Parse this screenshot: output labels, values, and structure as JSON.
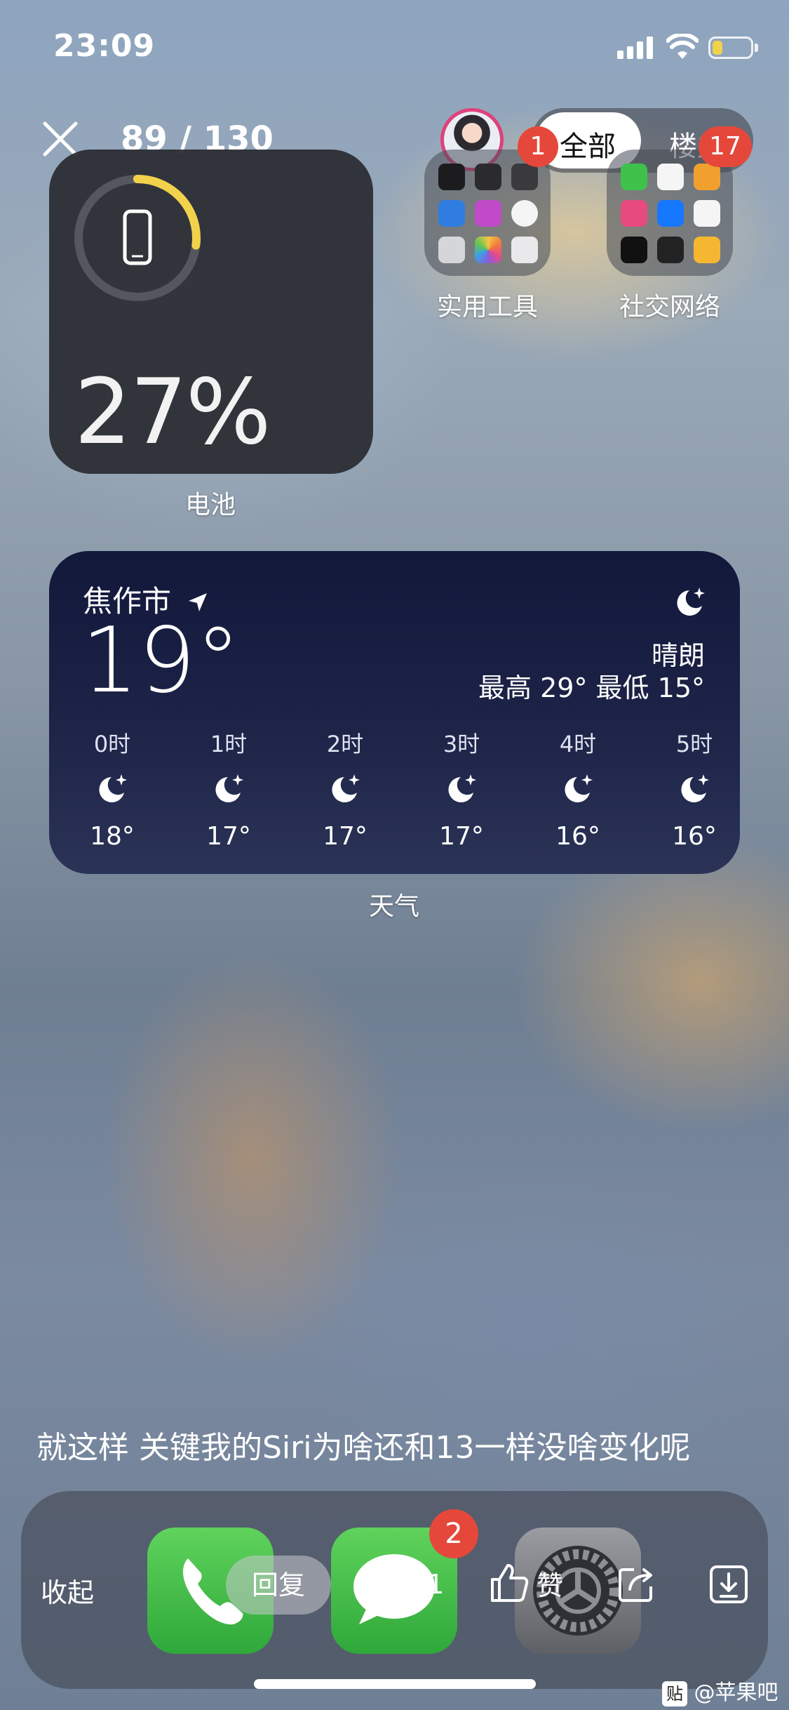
{
  "status_bar": {
    "time": "23:09"
  },
  "viewer": {
    "page_counter": "89 / 130",
    "filter_all": "全部",
    "filter_op": "楼主"
  },
  "battery_widget": {
    "percent": "27%",
    "label": "电池",
    "level": 0.27
  },
  "folders": [
    {
      "label": "实用工具",
      "badge": "1"
    },
    {
      "label": "社交网络",
      "badge": "17"
    }
  ],
  "weather": {
    "city": "焦作市",
    "temp": "19°",
    "condition": "晴朗",
    "high_low": "最高 29° 最低 15°",
    "label": "天气",
    "hours": [
      {
        "time": "0时",
        "temp": "18°"
      },
      {
        "time": "1时",
        "temp": "17°"
      },
      {
        "time": "2时",
        "temp": "17°"
      },
      {
        "time": "3时",
        "temp": "17°"
      },
      {
        "time": "4时",
        "temp": "16°"
      },
      {
        "time": "5时",
        "temp": "16°"
      }
    ]
  },
  "post_text": "就这样 关键我的Siri为啥还和13一样没啥变化呢",
  "dock": {
    "messages_badge": "2"
  },
  "actions": {
    "collapse": "收起",
    "reply": "回复",
    "comment_count": "1",
    "like": "赞"
  },
  "watermark": "@苹果吧",
  "watermark_icon": "贴",
  "colors": {
    "accent_yellow": "#f2d24b",
    "badge_red": "#e5483b",
    "avatar_ring": "#e0407a"
  }
}
